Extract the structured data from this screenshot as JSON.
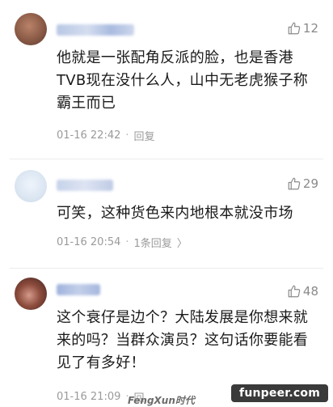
{
  "comments": [
    {
      "likes": "12",
      "text": "他就是一张配角反派的脸，也是香港TVB现在没什么人，山中无老虎猴子称霸王而已",
      "time": "01-16 22:42",
      "reply": "回复"
    },
    {
      "likes": "29",
      "text": "可笑，这种货色来内地根本就没市场",
      "time": "01-16 20:54",
      "reply": "1条回复"
    },
    {
      "likes": "48",
      "text": "这个衰仔是边个？大陆发展是你想来就来的吗？当群众演员？这句话你要能看见了有多好！",
      "time": "01-16 21:09",
      "reply": "回"
    }
  ],
  "watermark": "FengXun时代",
  "badge": "funpeer.com",
  "colors": {
    "text": "#1a1a1a",
    "meta": "#9a9a9a",
    "like": "#8a8a8a",
    "badge_bg": "#3a3a3a"
  },
  "icons": {
    "like": "thumbs-up-icon",
    "reply_more": "chevron-right-icon"
  }
}
